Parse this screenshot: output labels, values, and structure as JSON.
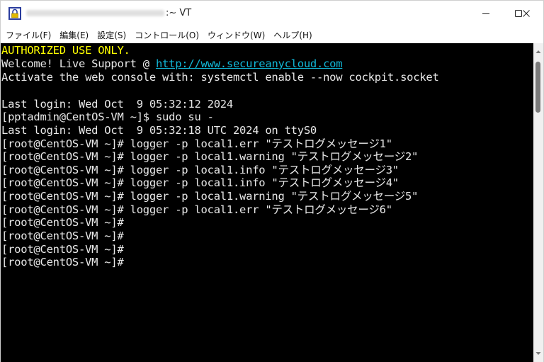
{
  "window": {
    "title": ":~ VT"
  },
  "menubar": {
    "items": [
      {
        "label": "ファイル(F)"
      },
      {
        "label": "編集(E)"
      },
      {
        "label": "設定(S)"
      },
      {
        "label": "コントロール(O)"
      },
      {
        "label": "ウィンドウ(W)"
      },
      {
        "label": "ヘルプ(H)"
      }
    ]
  },
  "terminal": {
    "banner": "AUTHORIZED USE ONLY.",
    "welcome_prefix": "Welcome! Live Support @ ",
    "welcome_link": "http://www.secureanycloud.com",
    "cockpit_line": "Activate the web console with: systemctl enable --now cockpit.socket",
    "lines": [
      "Last login: Wed Oct  9 05:32:12 2024",
      "[pptadmin@CentOS-VM ~]$ sudo su -",
      "Last login: Wed Oct  9 05:32:18 UTC 2024 on ttyS0",
      "[root@CentOS-VM ~]# logger -p local1.err \"テストログメッセージ1\"",
      "[root@CentOS-VM ~]# logger -p local1.warning \"テストログメッセージ2\"",
      "[root@CentOS-VM ~]# logger -p local1.info \"テストログメッセージ3\"",
      "[root@CentOS-VM ~]# logger -p local1.info \"テストログメッセージ4\"",
      "[root@CentOS-VM ~]# logger -p local1.warning \"テストログメッセージ5\"",
      "[root@CentOS-VM ~]# logger -p local1.err \"テストログメッセージ6\"",
      "[root@CentOS-VM ~]#",
      "[root@CentOS-VM ~]#",
      "[root@CentOS-VM ~]#",
      "[root@CentOS-VM ~]#"
    ]
  },
  "colors": {
    "banner": "#ffff00",
    "link": "#11b8d8",
    "text": "#e8e8e8",
    "background": "#000000"
  }
}
